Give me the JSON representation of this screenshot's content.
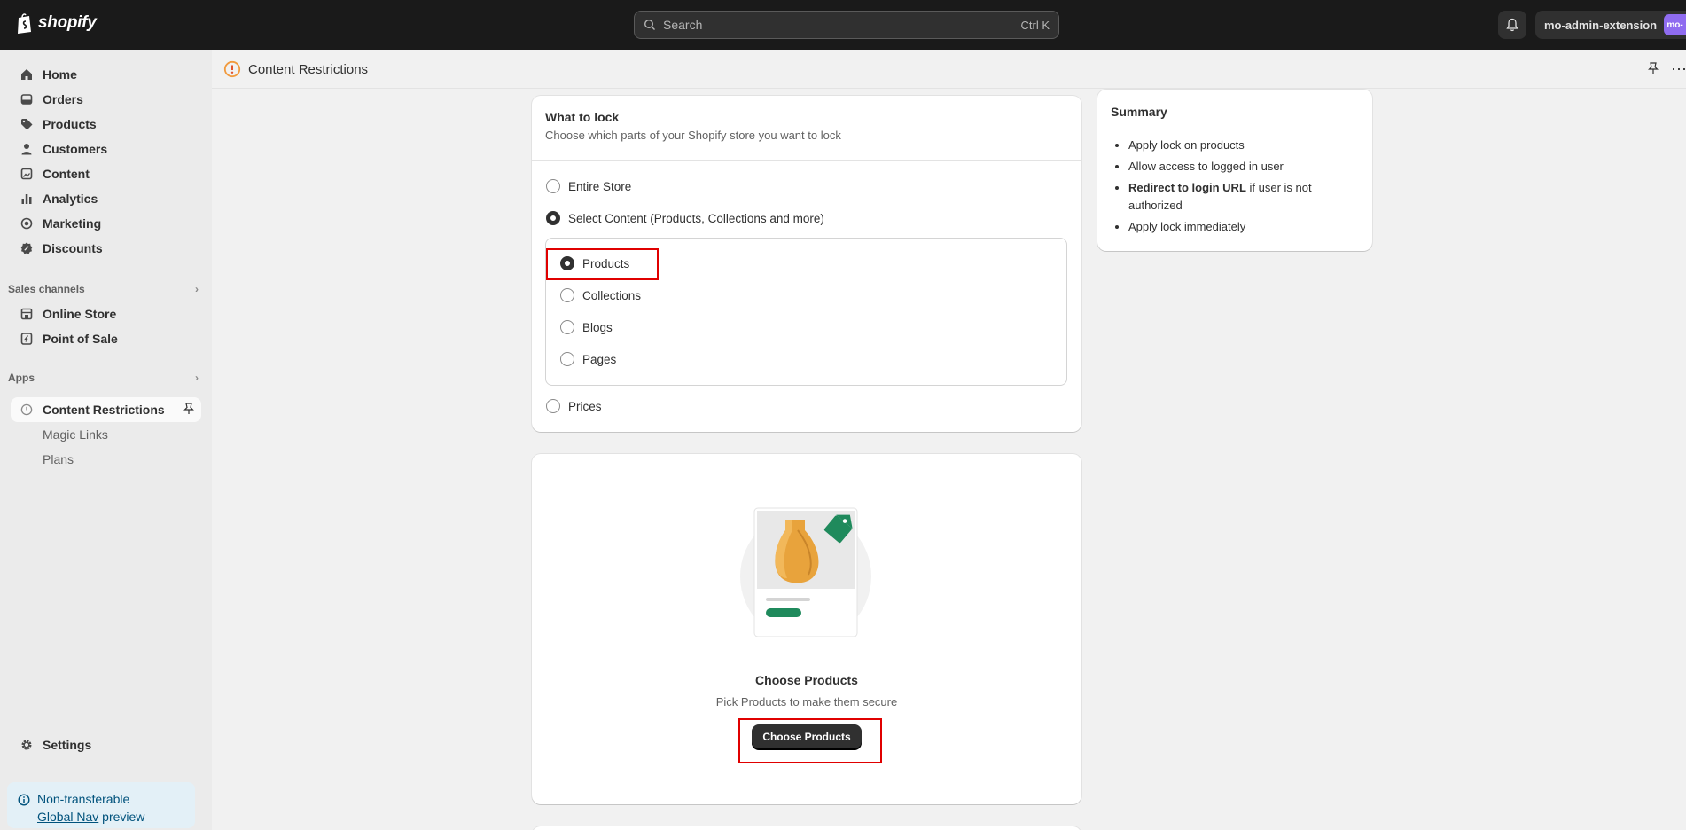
{
  "topbar": {
    "brand": "shopify",
    "search_placeholder": "Search",
    "search_shortcut": "Ctrl K",
    "account_name": "mo-admin-extension",
    "avatar_initials": "mo-"
  },
  "sidebar": {
    "items": [
      {
        "label": "Home",
        "icon": "home-icon"
      },
      {
        "label": "Orders",
        "icon": "orders-icon"
      },
      {
        "label": "Products",
        "icon": "tag-icon"
      },
      {
        "label": "Customers",
        "icon": "person-icon"
      },
      {
        "label": "Content",
        "icon": "content-icon"
      },
      {
        "label": "Analytics",
        "icon": "analytics-icon"
      },
      {
        "label": "Marketing",
        "icon": "target-icon"
      },
      {
        "label": "Discounts",
        "icon": "discount-icon"
      }
    ],
    "sales_channels_label": "Sales channels",
    "channels": [
      {
        "label": "Online Store",
        "icon": "store-icon"
      },
      {
        "label": "Point of Sale",
        "icon": "pos-icon"
      }
    ],
    "apps_label": "Apps",
    "apps": [
      {
        "label": "Content Restrictions"
      },
      {
        "label": "Magic Links"
      },
      {
        "label": "Plans"
      }
    ],
    "settings_label": "Settings",
    "notice": {
      "line1": "Non-transferable",
      "link": "Global Nav",
      "suffix": "preview"
    }
  },
  "page": {
    "title": "Content Restrictions"
  },
  "lock_card": {
    "title": "What to lock",
    "subtitle": "Choose which parts of your Shopify store you want to lock",
    "options": [
      "Entire Store",
      "Select Content (Products, Collections and more)",
      "Prices"
    ],
    "selected_option": "Select Content (Products, Collections and more)",
    "sub_options": [
      "Products",
      "Collections",
      "Blogs",
      "Pages"
    ],
    "selected_sub_option": "Products"
  },
  "products_card": {
    "title": "Choose Products",
    "subtitle": "Pick Products to make them secure",
    "button_label": "Choose Products"
  },
  "summary": {
    "title": "Summary",
    "items": [
      {
        "bold": "",
        "text": "Apply lock on products"
      },
      {
        "bold": "",
        "text": "Allow access to logged in user"
      },
      {
        "bold": "Redirect to login URL",
        "text": " if user is not authorized"
      },
      {
        "bold": "",
        "text": "Apply lock immediately"
      }
    ]
  },
  "colors": {
    "highlight": "#e00000",
    "topbar": "#1a1a1a",
    "avatar": "#8f6cf0"
  }
}
